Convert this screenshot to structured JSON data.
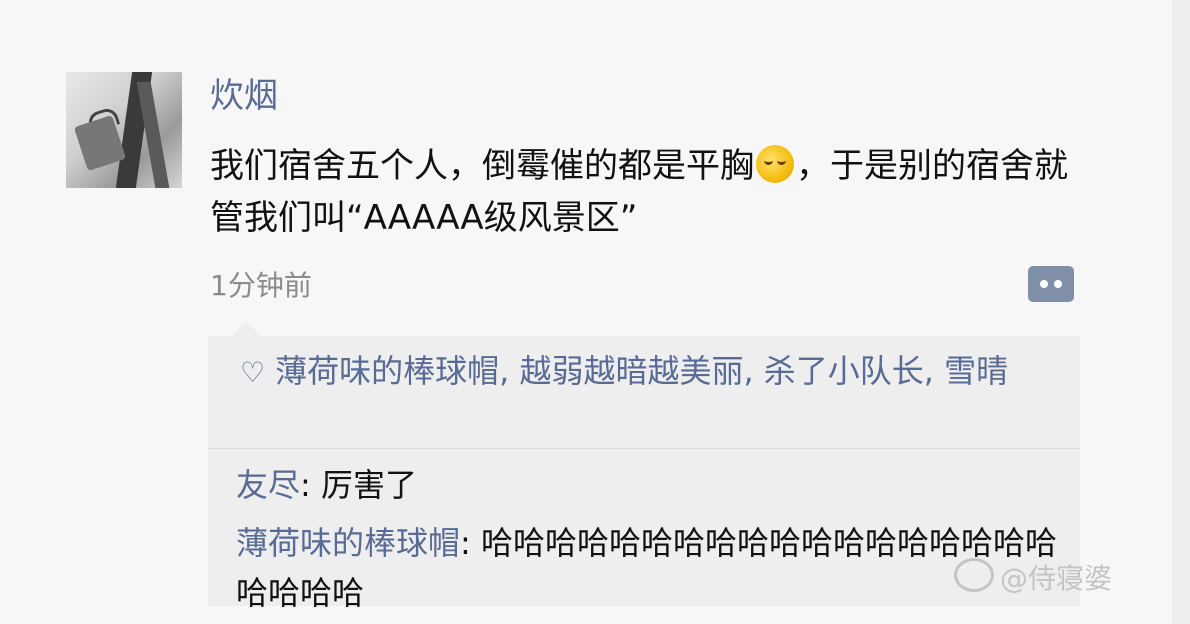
{
  "post": {
    "username": "炊烟",
    "text_before_emoji": "我们宿舍五个人，倒霉催的都是平胸",
    "emoji_icon": "laughing-crying-emoji-icon",
    "text_after_emoji": "，于是别的宿舍就管我们叫“AAAAA级风景区”",
    "timestamp": "1分钟前"
  },
  "likes": {
    "heart_glyph": "♡",
    "names": "薄荷味的棒球帽, 越弱越暗越美丽, 杀了小队长, 雪晴"
  },
  "comments": [
    {
      "name": "友尽",
      "sep": ": ",
      "text": "厉害了"
    },
    {
      "name": "薄荷味的棒球帽",
      "sep": ": ",
      "text": "哈哈哈哈哈哈哈哈哈哈哈哈哈哈哈哈哈哈哈哈哈哈"
    }
  ],
  "watermark": {
    "text": "@侍寝婆"
  },
  "colors": {
    "link": "#576b95",
    "background": "#f7f7f7",
    "comment_box": "#eeeeee"
  }
}
